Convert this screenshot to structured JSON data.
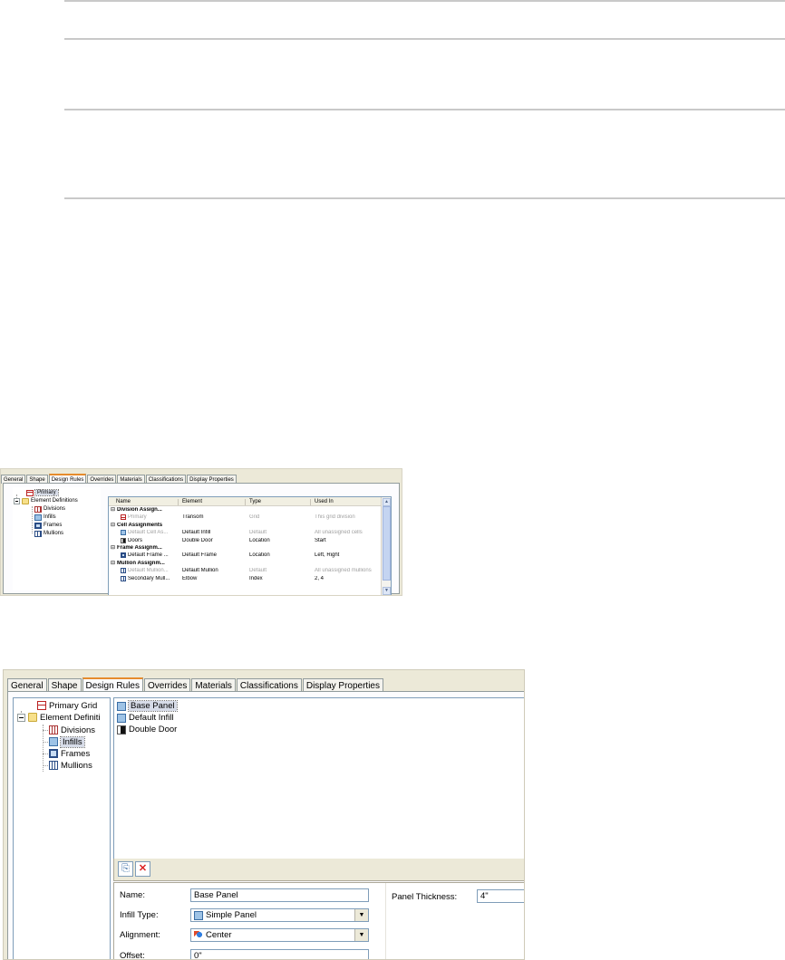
{
  "tabs": [
    "General",
    "Shape",
    "Design Rules",
    "Overrides",
    "Materials",
    "Classifications",
    "Display Properties"
  ],
  "active_tab": "Design Rules",
  "screenshot1": {
    "tree": {
      "root": "Primary",
      "folder": "Element Definitions",
      "children": [
        "Divisions",
        "Infills",
        "Frames",
        "Mullions"
      ]
    },
    "grid": {
      "columns": [
        "Name",
        "Element",
        "Type",
        "Used In"
      ],
      "rows": [
        {
          "kind": "group",
          "name": "Division Assign..."
        },
        {
          "kind": "row",
          "name": "Primary",
          "element": "Transom",
          "type": "Grid",
          "used_in": "This grid division",
          "grey": true
        },
        {
          "kind": "group",
          "name": "Cell Assignments"
        },
        {
          "kind": "row",
          "name": "Default Cell As...",
          "element": "Default Infill",
          "type": "Default",
          "used_in": "All unassigned cells",
          "grey": true
        },
        {
          "kind": "row",
          "name": "Doors",
          "element": "Double Door",
          "type": "Location",
          "used_in": "Start",
          "grey": false
        },
        {
          "kind": "group",
          "name": "Frame Assignm..."
        },
        {
          "kind": "row",
          "name": "Default Frame ...",
          "element": "Default Frame",
          "type": "Location",
          "used_in": "Left, Right",
          "grey": false
        },
        {
          "kind": "group",
          "name": "Mullion Assignm..."
        },
        {
          "kind": "row",
          "name": "Default Mullion...",
          "element": "Default Mullion",
          "type": "Default",
          "used_in": "All unassigned mullions",
          "grey": true
        },
        {
          "kind": "row",
          "name": "Secondary Mull...",
          "element": "Elbow",
          "type": "Index",
          "used_in": "2, 4",
          "grey": false
        }
      ]
    }
  },
  "screenshot2": {
    "tree": {
      "root": "Primary Grid",
      "folder": "Element Definiti",
      "children": [
        "Divisions",
        "Infills",
        "Frames",
        "Mullions"
      ],
      "selected": "Infills"
    },
    "list": [
      "Base Panel",
      "Default Infill",
      "Double Door"
    ],
    "properties": {
      "name_label": "Name:",
      "name_value": "Base Panel",
      "infill_type_label": "Infill Type:",
      "infill_type_value": "Simple Panel",
      "alignment_label": "Alignment:",
      "alignment_value": "Center",
      "offset_label": "Offset:",
      "offset_value": "0\"",
      "panel_thickness_label": "Panel Thickness:",
      "panel_thickness_value": "4\""
    }
  }
}
